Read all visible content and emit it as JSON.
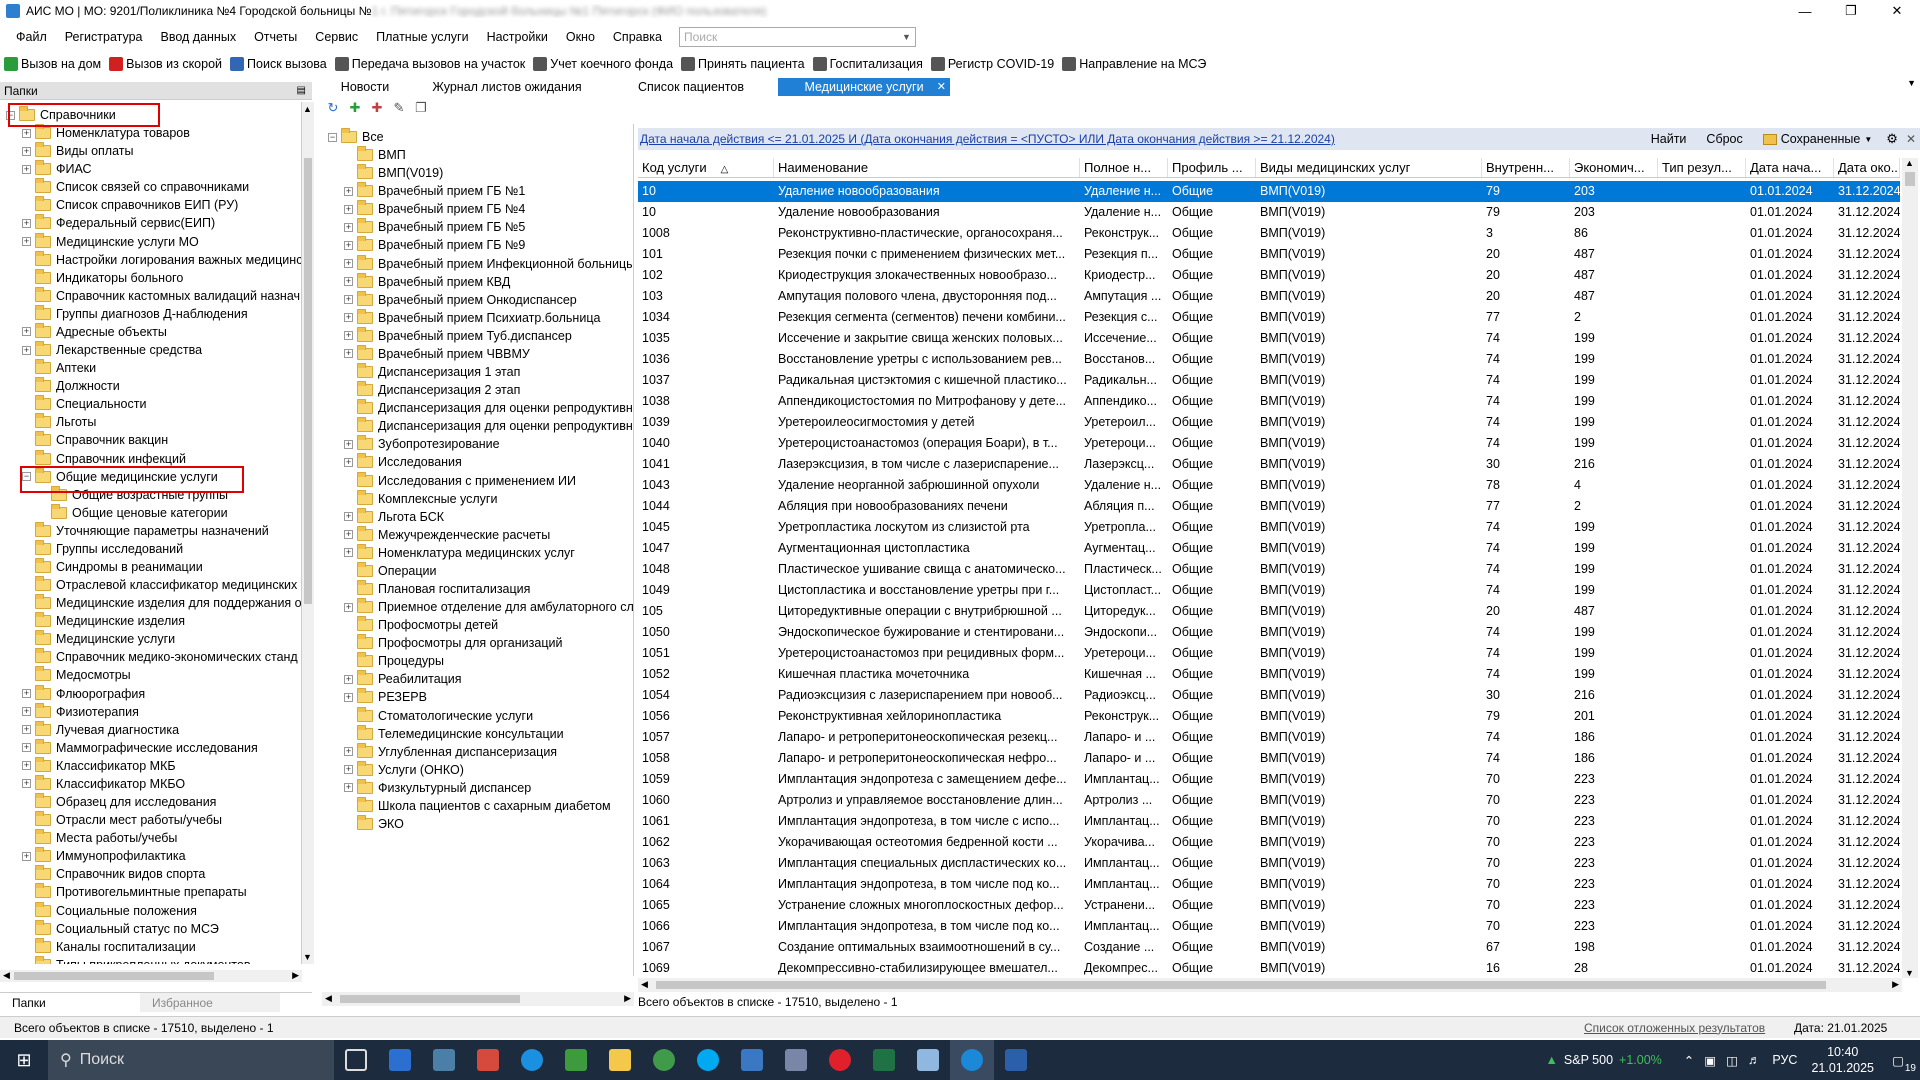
{
  "window": {
    "title": "АИС МО | МО: 9201/Поликлиника №4 Городской больницы №",
    "title_blurred": "1 г. Пятигорск Городской больницы №1 Пятигорск (ФИО пользователя)"
  },
  "menu": [
    "Файл",
    "Регистратура",
    "Ввод данных",
    "Отчеты",
    "Сервис",
    "Платные услуги",
    "Настройки",
    "Окно",
    "Справка"
  ],
  "search": {
    "placeholder": "Поиск"
  },
  "toolbar": [
    {
      "label": "Вызов на дом",
      "color": "#2a9d3a"
    },
    {
      "label": "Вызов из скорой",
      "color": "#d02020"
    },
    {
      "label": "Поиск вызова",
      "color": "#3367b5"
    },
    {
      "label": "Передача вызовов на участок",
      "color": "#555555"
    },
    {
      "label": "Учет коечного фонда",
      "color": "#555555"
    },
    {
      "label": "Принять пациента",
      "color": "#555555"
    },
    {
      "label": "Госпитализация",
      "color": "#555555"
    },
    {
      "label": "Регистр COVID-19",
      "color": "#555555"
    },
    {
      "label": "Направление на МСЭ",
      "color": "#555555"
    }
  ],
  "tabs": [
    {
      "label": "Новости"
    },
    {
      "label": "Журнал листов ожидания"
    },
    {
      "label": "Список пациентов"
    },
    {
      "label": "Медицинские услуги",
      "active": true
    }
  ],
  "left_panel": {
    "header": "Папки",
    "tree": [
      {
        "label": "Справочники",
        "expanded": true,
        "level": 0
      },
      {
        "label": "Номенклатура товаров",
        "level": 1,
        "has_children": true
      },
      {
        "label": "Виды оплаты",
        "level": 1,
        "has_children": true
      },
      {
        "label": "ФИАС",
        "level": 1,
        "has_children": true
      },
      {
        "label": "Список связей со справочниками",
        "level": 1
      },
      {
        "label": "Список справочников ЕИП (РУ)",
        "level": 1
      },
      {
        "label": "Федеральный сервис(ЕИП)",
        "level": 1,
        "has_children": true
      },
      {
        "label": "Медицинские услуги МО",
        "level": 1,
        "has_children": true
      },
      {
        "label": "Настройки логирования важных медицинс",
        "level": 1
      },
      {
        "label": "Индикаторы больного",
        "level": 1
      },
      {
        "label": "Справочник кастомных валидаций назнач",
        "level": 1
      },
      {
        "label": "Группы диагнозов Д-наблюдения",
        "level": 1
      },
      {
        "label": "Адресные объекты",
        "level": 1,
        "has_children": true
      },
      {
        "label": "Лекарственные средства",
        "level": 1,
        "has_children": true
      },
      {
        "label": "Аптеки",
        "level": 1
      },
      {
        "label": "Должности",
        "level": 1
      },
      {
        "label": "Специальности",
        "level": 1
      },
      {
        "label": "Льготы",
        "level": 1
      },
      {
        "label": "Справочник вакцин",
        "level": 1
      },
      {
        "label": "Справочник инфекций",
        "level": 1
      },
      {
        "label": "Общие медицинские услуги",
        "level": 1,
        "expanded": true
      },
      {
        "label": "Общие возрастные группы",
        "level": 2
      },
      {
        "label": "Общие ценовые категории",
        "level": 2
      },
      {
        "label": "Уточняющие параметры назначений",
        "level": 1
      },
      {
        "label": "Группы исследований",
        "level": 1
      },
      {
        "label": "Синдромы в реанимации",
        "level": 1
      },
      {
        "label": "Отраслевой классификатор медицинских у",
        "level": 1
      },
      {
        "label": "Медицинские изделия для поддержания ор",
        "level": 1
      },
      {
        "label": "Медицинские изделия",
        "level": 1
      },
      {
        "label": "Медицинские услуги",
        "level": 1
      },
      {
        "label": "Справочник медико-экономических станд",
        "level": 1
      },
      {
        "label": "Медосмотры",
        "level": 1
      },
      {
        "label": "Флюорография",
        "level": 1,
        "has_children": true
      },
      {
        "label": "Физиотерапия",
        "level": 1,
        "has_children": true
      },
      {
        "label": "Лучевая диагностика",
        "level": 1,
        "has_children": true
      },
      {
        "label": "Маммографические исследования",
        "level": 1,
        "has_children": true
      },
      {
        "label": "Классификатор МКБ",
        "level": 1,
        "has_children": true
      },
      {
        "label": "Классификатор МКБО",
        "level": 1,
        "has_children": true
      },
      {
        "label": "Образец для исследования",
        "level": 1
      },
      {
        "label": "Отрасли мест работы/учебы",
        "level": 1
      },
      {
        "label": "Места работы/учебы",
        "level": 1
      },
      {
        "label": "Иммунопрофилактика",
        "level": 1,
        "has_children": true
      },
      {
        "label": "Справочник видов спорта",
        "level": 1
      },
      {
        "label": "Противогельминтные препараты",
        "level": 1
      },
      {
        "label": "Социальные положения",
        "level": 1
      },
      {
        "label": "Социальный статус по МСЭ",
        "level": 1
      },
      {
        "label": "Каналы госпитализации",
        "level": 1
      },
      {
        "label": "Типы прикрепленных документов",
        "level": 1
      }
    ],
    "bottom_tabs": [
      "Папки",
      "Избранное"
    ]
  },
  "middle_panel": {
    "tree": [
      {
        "label": "Все",
        "level": 0,
        "expanded": true
      },
      {
        "label": "ВМП",
        "level": 1
      },
      {
        "label": "ВМП(V019)",
        "level": 1
      },
      {
        "label": "Врачебный прием ГБ №1",
        "level": 1,
        "has_children": true
      },
      {
        "label": "Врачебный прием ГБ №4",
        "level": 1,
        "has_children": true
      },
      {
        "label": "Врачебный прием ГБ №5",
        "level": 1,
        "has_children": true
      },
      {
        "label": "Врачебный прием ГБ №9",
        "level": 1,
        "has_children": true
      },
      {
        "label": "Врачебный прием Инфекционной больницы",
        "level": 1,
        "has_children": true
      },
      {
        "label": "Врачебный прием КВД",
        "level": 1,
        "has_children": true
      },
      {
        "label": "Врачебный прием Онкодиспансер",
        "level": 1,
        "has_children": true
      },
      {
        "label": "Врачебный прием Психиатр.больница",
        "level": 1,
        "has_children": true
      },
      {
        "label": "Врачебный прием Туб.диспансер",
        "level": 1,
        "has_children": true
      },
      {
        "label": "Врачебный прием ЧВВМУ",
        "level": 1,
        "has_children": true
      },
      {
        "label": "Диспансеризация 1 этап",
        "level": 1
      },
      {
        "label": "Диспансеризация 2 этап",
        "level": 1
      },
      {
        "label": "Диспансеризация для оценки репродуктивн",
        "level": 1
      },
      {
        "label": "Диспансеризация для оценки репродуктивн",
        "level": 1
      },
      {
        "label": "Зубопротезирование",
        "level": 1,
        "has_children": true
      },
      {
        "label": "Исследования",
        "level": 1,
        "has_children": true
      },
      {
        "label": "Исследования с применением ИИ",
        "level": 1
      },
      {
        "label": "Комплексные услуги",
        "level": 1
      },
      {
        "label": "Льгота БСК",
        "level": 1,
        "has_children": true
      },
      {
        "label": "Межучрежденческие расчеты",
        "level": 1,
        "has_children": true
      },
      {
        "label": "Номенклатура медицинских услуг",
        "level": 1,
        "has_children": true
      },
      {
        "label": "Операции",
        "level": 1
      },
      {
        "label": "Плановая госпитализация",
        "level": 1
      },
      {
        "label": "Приемное отделение для амбулаторного слу",
        "level": 1,
        "has_children": true
      },
      {
        "label": "Профосмотры детей",
        "level": 1
      },
      {
        "label": "Профосмотры для организаций",
        "level": 1
      },
      {
        "label": "Процедуры",
        "level": 1
      },
      {
        "label": "Реабилитация",
        "level": 1,
        "has_children": true
      },
      {
        "label": "РЕЗЕРВ",
        "level": 1,
        "has_children": true
      },
      {
        "label": "Стоматологические услуги",
        "level": 1
      },
      {
        "label": "Телемедицинские консультации",
        "level": 1
      },
      {
        "label": "Углубленная диспансеризация",
        "level": 1,
        "has_children": true
      },
      {
        "label": "Услуги (ОНКО)",
        "level": 1,
        "has_children": true
      },
      {
        "label": "Физкультурный диспансер",
        "level": 1,
        "has_children": true
      },
      {
        "label": "Школа пациентов с сахарным диабетом",
        "level": 1
      },
      {
        "label": "ЭКО",
        "level": 1
      }
    ]
  },
  "filter": {
    "text": "Дата начала действия <= 21.01.2025 И (Дата окончания действия = <ПУСТО> ИЛИ Дата окончания действия >= 21.12.2024)",
    "find": "Найти",
    "reset": "Сброс",
    "saved": "Сохраненные"
  },
  "grid": {
    "columns": [
      "Код услуги",
      "Наименование",
      "Полное н...",
      "Профиль ...",
      "Виды медицинских услуг",
      "Внутренн...",
      "Экономич...",
      "Тип резул...",
      "Дата нача...",
      "Дата око..."
    ],
    "rows": [
      [
        "10",
        "Удаление новообразования",
        "Удаление н...",
        "Общие",
        "ВМП(V019)",
        "79",
        "203",
        "",
        "01.01.2024",
        "31.12.2024"
      ],
      [
        "10",
        "Удаление новообразования",
        "Удаление н...",
        "Общие",
        "ВМП(V019)",
        "79",
        "203",
        "",
        "01.01.2024",
        "31.12.2024"
      ],
      [
        "1008",
        "Реконструктивно-пластические, органосохраня...",
        "Реконструк...",
        "Общие",
        "ВМП(V019)",
        "3",
        "86",
        "",
        "01.01.2024",
        "31.12.2024"
      ],
      [
        "101",
        "Резекция почки с применением физических мет...",
        "Резекция п...",
        "Общие",
        "ВМП(V019)",
        "20",
        "487",
        "",
        "01.01.2024",
        "31.12.2024"
      ],
      [
        "102",
        "Криодеструкция злокачественных новообразо...",
        "Криодестр...",
        "Общие",
        "ВМП(V019)",
        "20",
        "487",
        "",
        "01.01.2024",
        "31.12.2024"
      ],
      [
        "103",
        "Ампутация полового члена, двусторонняя под...",
        "Ампутация ...",
        "Общие",
        "ВМП(V019)",
        "20",
        "487",
        "",
        "01.01.2024",
        "31.12.2024"
      ],
      [
        "1034",
        "Резекция сегмента (сегментов) печени комбини...",
        "Резекция с...",
        "Общие",
        "ВМП(V019)",
        "77",
        "2",
        "",
        "01.01.2024",
        "31.12.2024"
      ],
      [
        "1035",
        "Иссечение и закрытие свища женских половых...",
        "Иссечение...",
        "Общие",
        "ВМП(V019)",
        "74",
        "199",
        "",
        "01.01.2024",
        "31.12.2024"
      ],
      [
        "1036",
        "Восстановление уретры с использованием рев...",
        "Восстанов...",
        "Общие",
        "ВМП(V019)",
        "74",
        "199",
        "",
        "01.01.2024",
        "31.12.2024"
      ],
      [
        "1037",
        "Радикальная цистэктомия с кишечной пластико...",
        "Радикальн...",
        "Общие",
        "ВМП(V019)",
        "74",
        "199",
        "",
        "01.01.2024",
        "31.12.2024"
      ],
      [
        "1038",
        "Аппендикоцистостомия по Митрофанову у дете...",
        "Аппендико...",
        "Общие",
        "ВМП(V019)",
        "74",
        "199",
        "",
        "01.01.2024",
        "31.12.2024"
      ],
      [
        "1039",
        "Уретероилеосигмостомия у детей",
        "Уретероил...",
        "Общие",
        "ВМП(V019)",
        "74",
        "199",
        "",
        "01.01.2024",
        "31.12.2024"
      ],
      [
        "1040",
        "Уретероцистоанастомоз (операция Боари), в т...",
        "Уретероци...",
        "Общие",
        "ВМП(V019)",
        "74",
        "199",
        "",
        "01.01.2024",
        "31.12.2024"
      ],
      [
        "1041",
        "Лазерэксцизия, в том числе с лазериспарение...",
        "Лазерэксц...",
        "Общие",
        "ВМП(V019)",
        "30",
        "216",
        "",
        "01.01.2024",
        "31.12.2024"
      ],
      [
        "1043",
        "Удаление неорганной забрюшинной опухоли",
        "Удаление н...",
        "Общие",
        "ВМП(V019)",
        "78",
        "4",
        "",
        "01.01.2024",
        "31.12.2024"
      ],
      [
        "1044",
        "Абляция при новообразованиях печени",
        "Абляция п...",
        "Общие",
        "ВМП(V019)",
        "77",
        "2",
        "",
        "01.01.2024",
        "31.12.2024"
      ],
      [
        "1045",
        "Уретропластика лоскутом из слизистой рта",
        "Уретропла...",
        "Общие",
        "ВМП(V019)",
        "74",
        "199",
        "",
        "01.01.2024",
        "31.12.2024"
      ],
      [
        "1047",
        "Аугментационная цистопластика",
        "Аугментац...",
        "Общие",
        "ВМП(V019)",
        "74",
        "199",
        "",
        "01.01.2024",
        "31.12.2024"
      ],
      [
        "1048",
        "Пластическое ушивание свища с анатомическо...",
        "Пластическ...",
        "Общие",
        "ВМП(V019)",
        "74",
        "199",
        "",
        "01.01.2024",
        "31.12.2024"
      ],
      [
        "1049",
        "Цистопластика и восстановление уретры при г...",
        "Цистопласт...",
        "Общие",
        "ВМП(V019)",
        "74",
        "199",
        "",
        "01.01.2024",
        "31.12.2024"
      ],
      [
        "105",
        "Циторедуктивные операции с внутрибрюшной ...",
        "Циторедук...",
        "Общие",
        "ВМП(V019)",
        "20",
        "487",
        "",
        "01.01.2024",
        "31.12.2024"
      ],
      [
        "1050",
        "Эндоскопическое бужирование и стентировани...",
        "Эндоскопи...",
        "Общие",
        "ВМП(V019)",
        "74",
        "199",
        "",
        "01.01.2024",
        "31.12.2024"
      ],
      [
        "1051",
        "Уретероцистоанастомоз при рецидивных форм...",
        "Уретероци...",
        "Общие",
        "ВМП(V019)",
        "74",
        "199",
        "",
        "01.01.2024",
        "31.12.2024"
      ],
      [
        "1052",
        "Кишечная пластика мочеточника",
        "Кишечная ...",
        "Общие",
        "ВМП(V019)",
        "74",
        "199",
        "",
        "01.01.2024",
        "31.12.2024"
      ],
      [
        "1054",
        "Радиоэксцизия с лазериспарением при новооб...",
        "Радиоэксц...",
        "Общие",
        "ВМП(V019)",
        "30",
        "216",
        "",
        "01.01.2024",
        "31.12.2024"
      ],
      [
        "1056",
        "Реконструктивная хейлоринопластика",
        "Реконструк...",
        "Общие",
        "ВМП(V019)",
        "79",
        "201",
        "",
        "01.01.2024",
        "31.12.2024"
      ],
      [
        "1057",
        "Лапаро- и ретроперитонеоскопическая резекц...",
        "Лапаро- и ...",
        "Общие",
        "ВМП(V019)",
        "74",
        "186",
        "",
        "01.01.2024",
        "31.12.2024"
      ],
      [
        "1058",
        "Лапаро- и ретроперитонеоскопическая нефро...",
        "Лапаро- и ...",
        "Общие",
        "ВМП(V019)",
        "74",
        "186",
        "",
        "01.01.2024",
        "31.12.2024"
      ],
      [
        "1059",
        "Имплантация эндопротеза с замещением дефе...",
        "Имплантац...",
        "Общие",
        "ВМП(V019)",
        "70",
        "223",
        "",
        "01.01.2024",
        "31.12.2024"
      ],
      [
        "1060",
        "Артролиз и управляемое восстановление длин...",
        "Артролиз ...",
        "Общие",
        "ВМП(V019)",
        "70",
        "223",
        "",
        "01.01.2024",
        "31.12.2024"
      ],
      [
        "1061",
        "Имплантация эндопротеза, в том числе с испо...",
        "Имплантац...",
        "Общие",
        "ВМП(V019)",
        "70",
        "223",
        "",
        "01.01.2024",
        "31.12.2024"
      ],
      [
        "1062",
        "Укорачивающая остеотомия бедренной кости ...",
        "Укорачива...",
        "Общие",
        "ВМП(V019)",
        "70",
        "223",
        "",
        "01.01.2024",
        "31.12.2024"
      ],
      [
        "1063",
        "Имплантация специальных диспластических ко...",
        "Имплантац...",
        "Общие",
        "ВМП(V019)",
        "70",
        "223",
        "",
        "01.01.2024",
        "31.12.2024"
      ],
      [
        "1064",
        "Имплантация эндопротеза, в том числе под ко...",
        "Имплантац...",
        "Общие",
        "ВМП(V019)",
        "70",
        "223",
        "",
        "01.01.2024",
        "31.12.2024"
      ],
      [
        "1065",
        "Устранение сложных многоплоскостных дефор...",
        "Устранени...",
        "Общие",
        "ВМП(V019)",
        "70",
        "223",
        "",
        "01.01.2024",
        "31.12.2024"
      ],
      [
        "1066",
        "Имплантация эндопротеза, в том числе под ко...",
        "Имплантац...",
        "Общие",
        "ВМП(V019)",
        "70",
        "223",
        "",
        "01.01.2024",
        "31.12.2024"
      ],
      [
        "1067",
        "Создание оптимальных взаимоотношений в су...",
        "Создание ...",
        "Общие",
        "ВМП(V019)",
        "67",
        "198",
        "",
        "01.01.2024",
        "31.12.2024"
      ],
      [
        "1069",
        "Декомпрессивно-стабилизирующее вмешател...",
        "Декомпрес...",
        "Общие",
        "ВМП(V019)",
        "16",
        "28",
        "",
        "01.01.2024",
        "31.12.2024"
      ]
    ]
  },
  "status": {
    "left": "Всего объектов в списке - 17510, выделено - 1",
    "grid": "Всего объектов в списке - 17510, выделено - 1",
    "deferred": "Список отложенных результатов",
    "date": "Дата: 21.01.2025"
  },
  "taskbar": {
    "search": "Поиск",
    "stock": "S&P 500",
    "stock_change": "+1.00%",
    "lang": "РУС",
    "time": "10:40",
    "date": "21.01.2025",
    "notifications": "19"
  }
}
